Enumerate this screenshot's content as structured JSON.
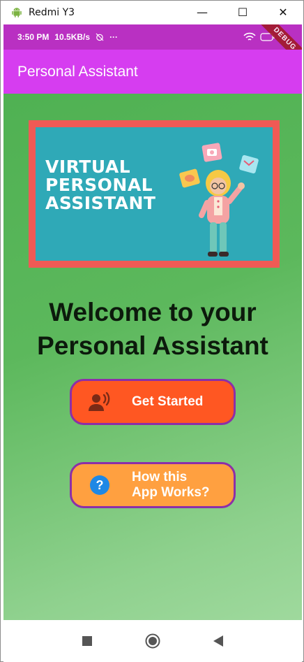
{
  "window": {
    "title": "Redmi Y3",
    "minimize": "—",
    "maximize": "☐",
    "close": "✕"
  },
  "statusbar": {
    "time": "3:50 PM",
    "speed": "10.5KB/s",
    "more": "···",
    "debug": "DEBUG"
  },
  "appbar": {
    "title": "Personal Assistant",
    "color": "#d63df0"
  },
  "banner": {
    "line1": "VIRTUAL",
    "line2": "PERSONAL",
    "line3": "ASSISTANT"
  },
  "welcome": {
    "line1": "Welcome to your",
    "line2": "Personal Assistant"
  },
  "buttons": {
    "get_started": "Get Started",
    "how_line1": "How this",
    "how_line2": "App Works?"
  },
  "icons": {
    "speaker": "record-voice-icon",
    "help": "help-icon",
    "nav_recent": "square-icon",
    "nav_home": "circle-icon",
    "nav_back": "triangle-back-icon"
  },
  "colors": {
    "statusbar": "#b930c2",
    "start_button": "#ff5722",
    "how_button": "#ffa040",
    "button_border": "#8c2fa8",
    "banner_border": "#f05a55",
    "banner_fill": "#2fa9b7"
  }
}
